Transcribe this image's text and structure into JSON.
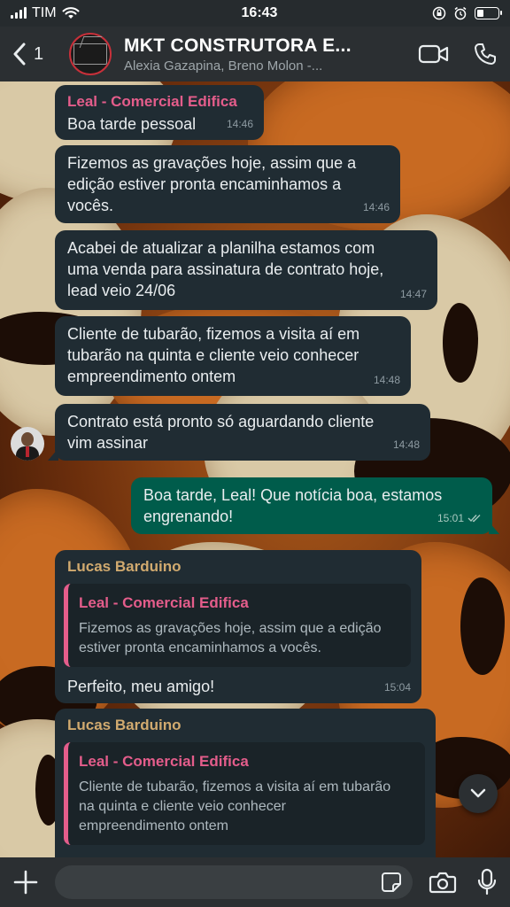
{
  "status_bar": {
    "carrier": "TIM",
    "time": "16:43"
  },
  "header": {
    "back_count": "1",
    "group_name": "MKT CONSTRUTORA E...",
    "members": "Alexia Gazapina, Breno Molon -..."
  },
  "messages": [
    {
      "sender": "Leal - Comercial Edifica",
      "text": "Boa tarde pessoal",
      "time": "14:46"
    },
    {
      "text_lines": [
        "Fizemos as gravações hoje, assim que a",
        "edição estiver pronta encaminhamos a",
        "vocês."
      ],
      "time": "14:46"
    },
    {
      "text_lines": [
        "Acabei de atualizar a planilha estamos com",
        "uma venda para assinatura de contrato hoje,",
        "lead veio 24/06"
      ],
      "time": "14:47"
    },
    {
      "text_lines": [
        "Cliente de tubarão, fizemos a visita aí em",
        "tubarão na quinta e cliente veio conhecer",
        "empreendimento ontem"
      ],
      "time": "14:48"
    },
    {
      "text_lines": [
        "Contrato está pronto só aguardando cliente",
        "vim assinar"
      ],
      "time": "14:48"
    },
    {
      "text_lines": [
        "Boa tarde, Leal! Que notícia boa, estamos",
        "engrenando!"
      ],
      "time": "15:01"
    },
    {
      "sender": "Lucas Barduino",
      "quote_sender": "Leal - Comercial Edifica",
      "quote_lines": [
        "Fizemos as gravações hoje, assim que a edição",
        "estiver pronta encaminhamos a vocês."
      ],
      "text": "Perfeito, meu amigo!",
      "time": "15:04"
    },
    {
      "sender": "Lucas Barduino",
      "quote_sender": "Leal - Comercial Edifica",
      "quote_lines": [
        "Cliente de tubarão, fizemos a visita aí em tubarão",
        "na quinta e cliente veio conhecer",
        "empreendimento ontem"
      ]
    }
  ],
  "input": {
    "placeholder": ""
  },
  "colors": {
    "incoming_bubble": "#202c33",
    "outgoing_bubble": "#005c4b",
    "leal_name": "#e45d8b",
    "lucas_name": "#d1aa6f",
    "header_bg": "#2b2f32"
  },
  "icons": [
    "back-chevron-icon",
    "video-call-icon",
    "phone-icon",
    "chevron-down-icon",
    "plus-icon",
    "sticker-icon",
    "camera-icon",
    "microphone-icon",
    "read-receipt-icon"
  ]
}
